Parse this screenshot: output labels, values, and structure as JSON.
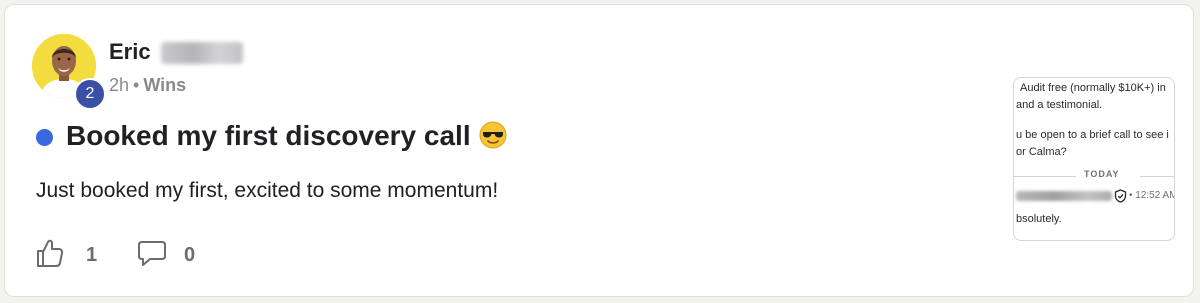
{
  "post": {
    "author": {
      "name": "Eric",
      "level": "2"
    },
    "time": "2h",
    "separator": "•",
    "category": "Wins",
    "title": "Booked my first discovery call",
    "body": "Just booked my first, excited to some momentum!",
    "likes": "1",
    "comments": "0"
  },
  "attachment": {
    "lines": [
      "Audit free (normally $10K+) in",
      "and a testimonial.",
      "u be open to a brief call to see i",
      "or Calma?"
    ],
    "divider_label": "TODAY",
    "time": "• 12:52 AM",
    "reply": "bsolutely."
  },
  "colors": {
    "unread_dot": "#3b67e0",
    "level_badge": "#3b4fa8",
    "avatar_bg": "#f3dc3e"
  },
  "icons": {
    "like": "thumbs-up-icon",
    "comment": "speech-bubble-icon",
    "emoji": "sunglasses-emoji",
    "verified": "shield-check-icon"
  }
}
